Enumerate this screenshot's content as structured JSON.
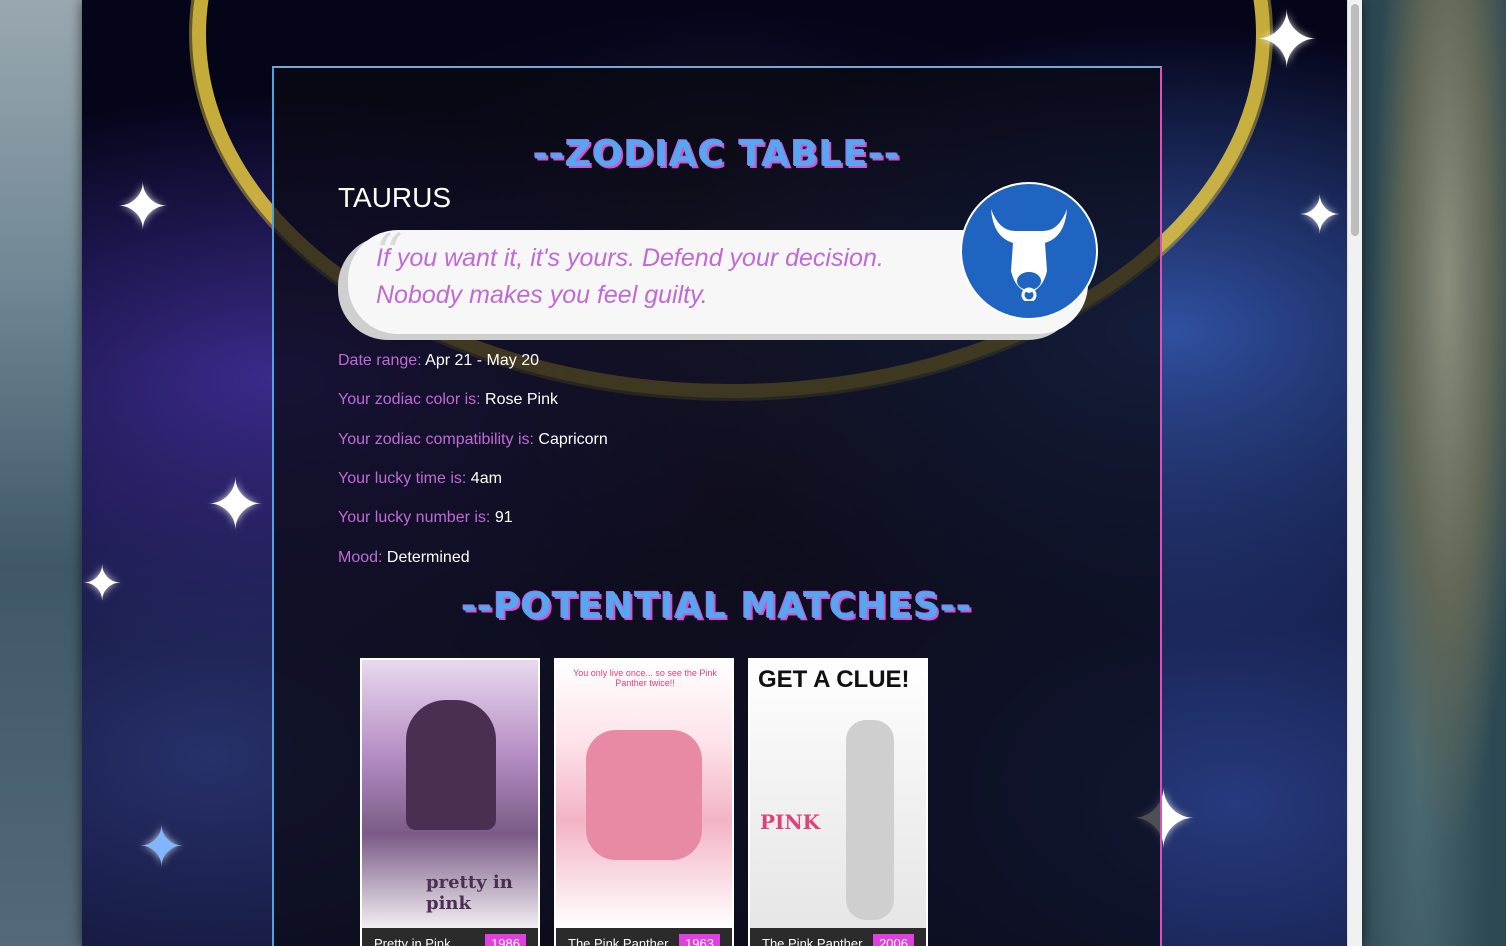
{
  "page": {
    "title1": "--ZODIAC TABLE--",
    "title2": "--POTENTIAL MATCHES--"
  },
  "sign": {
    "name": "TAURUS",
    "quote": "If you want it, it's yours. Defend your decision. Nobody makes you feel guilty.",
    "icon": "bull-icon"
  },
  "details": [
    {
      "label": "Date range:",
      "value": "Apr 21 - May 20"
    },
    {
      "label": "Your zodiac color is:",
      "value": "Rose Pink"
    },
    {
      "label": "Your zodiac compatibility is:",
      "value": "Capricorn"
    },
    {
      "label": "Your lucky time is:",
      "value": "4am"
    },
    {
      "label": "Your lucky number is:",
      "value": "91"
    },
    {
      "label": "Mood:",
      "value": "Determined"
    }
  ],
  "movies": [
    {
      "title": "Pretty in Pink",
      "year": "1986",
      "poster_text": "pretty in pink"
    },
    {
      "title": "The Pink Panther",
      "year": "1963",
      "poster_text": "You only live once... so see the Pink Panther twice!!"
    },
    {
      "title": "The Pink Panther",
      "year": "2006",
      "poster_text": "GET A CLUE!"
    }
  ],
  "colors": {
    "title_blue": "#55a8f0",
    "title_pink": "#d84fd0",
    "label_purple": "#c06ad6",
    "badge_blue": "#1f64c0",
    "year_pink": "#e040e0"
  }
}
